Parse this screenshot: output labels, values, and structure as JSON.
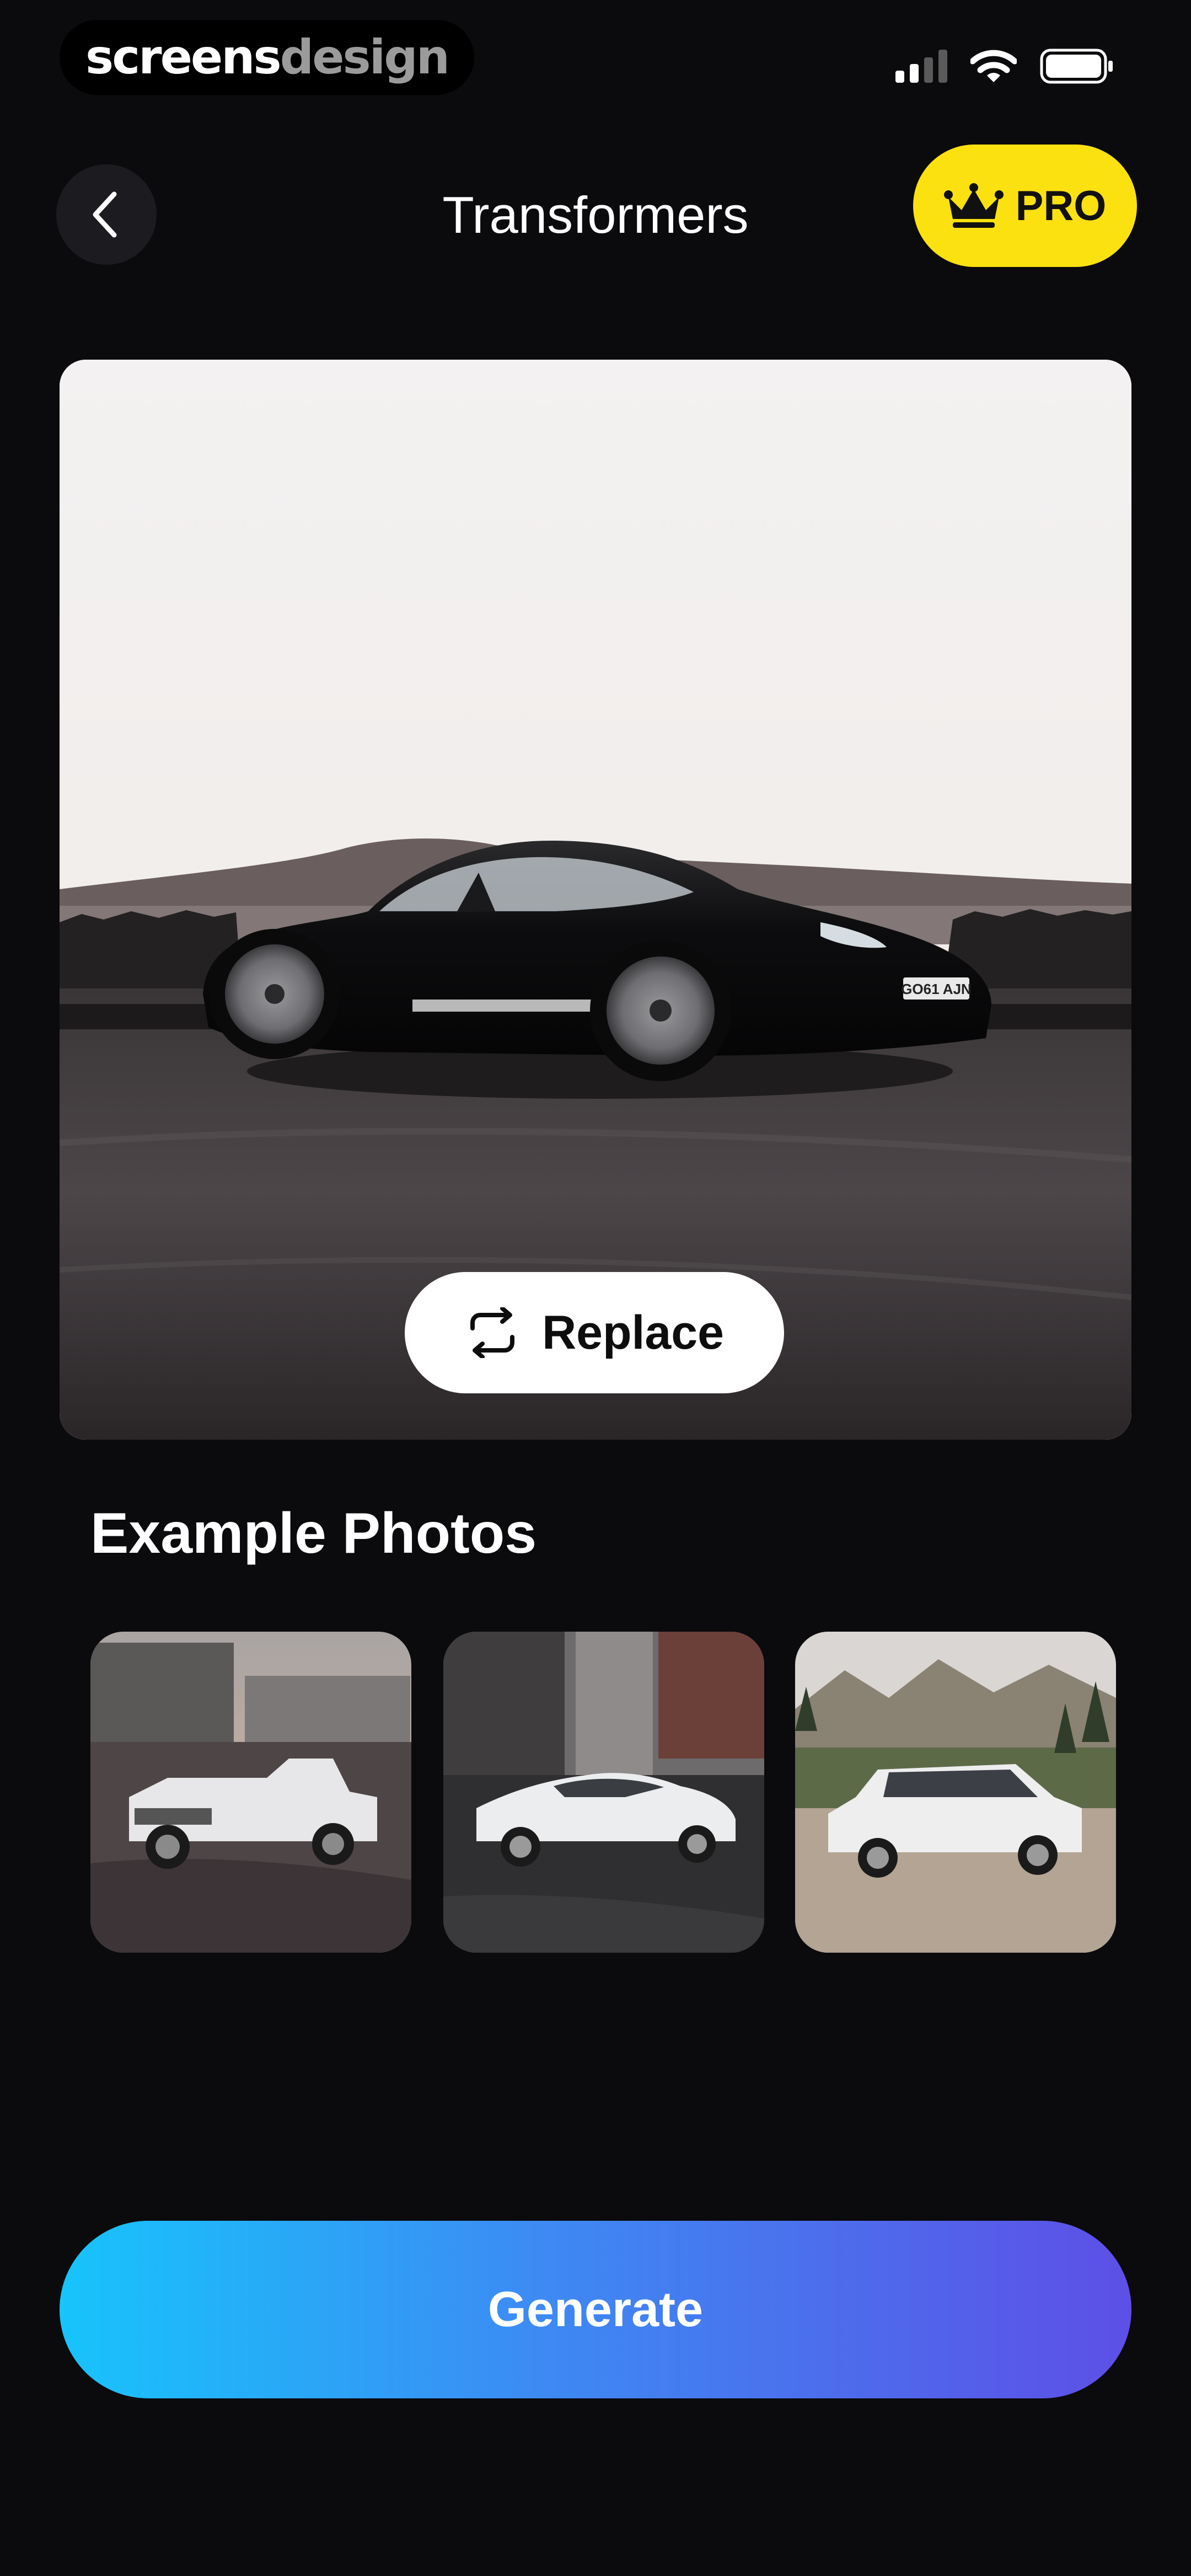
{
  "status_bar": {
    "brand_part1": "screens",
    "brand_part2": "design",
    "icons": [
      "cellular-signal-icon",
      "wifi-icon",
      "battery-icon"
    ]
  },
  "header": {
    "back_icon": "chevron-left-icon",
    "title": "Transformers",
    "pro_badge": {
      "icon": "crown-icon",
      "label": "PRO",
      "color": "#fbe10f"
    }
  },
  "main_photo": {
    "subject": "black sports car photo",
    "license_plate": "GO61 AJN",
    "replace_button": {
      "icon": "replace-arrows-icon",
      "label": "Replace"
    }
  },
  "examples": {
    "title": "Example Photos",
    "items": [
      {
        "name": "example-photo-pickup-truck"
      },
      {
        "name": "example-photo-sedan"
      },
      {
        "name": "example-photo-suv"
      }
    ]
  },
  "generate_button": {
    "label": "Generate",
    "gradient": [
      "#17c4fb",
      "#3d8af3",
      "#5d4fe6"
    ]
  },
  "colors": {
    "background": "#0b0a0d",
    "surface": "#1c1b1f",
    "accent_yellow": "#fbe10f"
  }
}
